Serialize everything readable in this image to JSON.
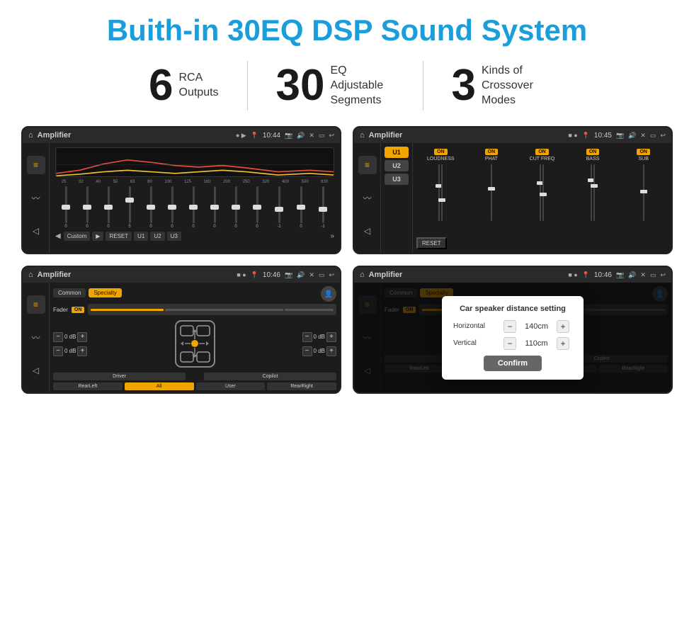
{
  "title": "Buith-in 30EQ DSP Sound System",
  "stats": [
    {
      "number": "6",
      "label": "RCA\nOutputs"
    },
    {
      "number": "30",
      "label": "EQ Adjustable\nSegments"
    },
    {
      "number": "3",
      "label": "Kinds of\nCrossover Modes"
    }
  ],
  "screens": [
    {
      "id": "screen1",
      "topbar": {
        "title": "Amplifier",
        "time": "10:44"
      },
      "type": "eq"
    },
    {
      "id": "screen2",
      "topbar": {
        "title": "Amplifier",
        "time": "10:45"
      },
      "type": "amp2"
    },
    {
      "id": "screen3",
      "topbar": {
        "title": "Amplifier",
        "time": "10:46"
      },
      "type": "fader"
    },
    {
      "id": "screen4",
      "topbar": {
        "title": "Amplifier",
        "time": "10:46"
      },
      "type": "fader-dialog"
    }
  ],
  "eq": {
    "bands": [
      "25",
      "32",
      "40",
      "50",
      "63",
      "80",
      "100",
      "125",
      "160",
      "200",
      "250",
      "320",
      "400",
      "500",
      "630"
    ],
    "values": [
      "0",
      "0",
      "0",
      "5",
      "0",
      "0",
      "0",
      "0",
      "0",
      "0",
      "-1",
      "0",
      "-1"
    ],
    "presets": [
      "Custom",
      "RESET",
      "U1",
      "U2",
      "U3"
    ]
  },
  "amp2": {
    "presets": [
      "U1",
      "U2",
      "U3"
    ],
    "controls": [
      "LOUDNESS",
      "PHAT",
      "CUT FREQ",
      "BASS",
      "SUB"
    ],
    "reset": "RESET"
  },
  "fader": {
    "tabs": [
      "Common",
      "Specialty"
    ],
    "fader_label": "Fader",
    "fader_on": "ON",
    "positions": [
      "Driver",
      "Copilot",
      "RearLeft",
      "All",
      "User",
      "RearRight"
    ],
    "db_labels": [
      "0 dB",
      "0 dB",
      "0 dB",
      "0 dB"
    ]
  },
  "dialog": {
    "title": "Car speaker distance setting",
    "horizontal_label": "Horizontal",
    "horizontal_value": "140cm",
    "vertical_label": "Vertical",
    "vertical_value": "110cm",
    "confirm_label": "Confirm"
  }
}
